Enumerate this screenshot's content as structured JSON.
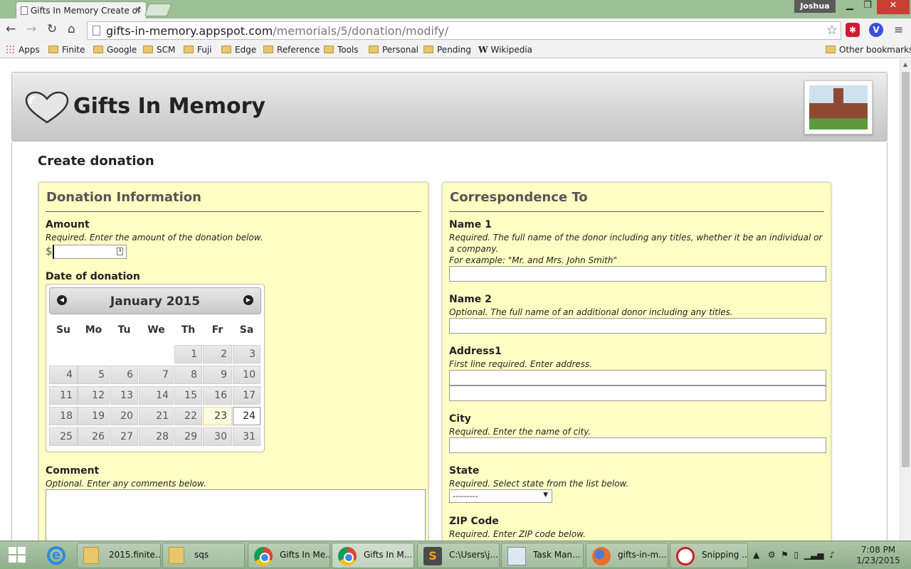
{
  "browser": {
    "tab_title": "Gifts In Memory Create of",
    "user": "Joshua",
    "url_host": "gifts-in-memory.appspot.com",
    "url_path": "/memorials/5/donation/modify/",
    "bookmarks": [
      "Apps",
      "Finite",
      "Google",
      "SCM",
      "Fuji",
      "Edge",
      "Reference",
      "Tools",
      "Personal",
      "Pending",
      "Wikipedia"
    ],
    "other_bookmarks": "Other bookmarks"
  },
  "site": {
    "title": "Gifts In Memory"
  },
  "page": {
    "title": "Create donation"
  },
  "donation": {
    "heading": "Donation Information",
    "amount_label": "Amount",
    "amount_help": "Required. Enter the amount of the donation below.",
    "currency": "$",
    "amount_value": "",
    "date_label": "Date of donation",
    "calendar": {
      "month_year": "January 2015",
      "weekdays": [
        "Su",
        "Mo",
        "Tu",
        "We",
        "Th",
        "Fr",
        "Sa"
      ],
      "first_weekday": 4,
      "days_in_month": 31,
      "today": 23,
      "selected": 24
    },
    "comment_label": "Comment",
    "comment_help": "Optional. Enter any comments below."
  },
  "correspondence": {
    "heading": "Correspondence To",
    "name1_label": "Name 1",
    "name1_help": "Required. The full name of the donor including any titles, whether it be an individual or a company.",
    "name1_example": "For example: \"Mr. and Mrs. John Smith\"",
    "name2_label": "Name 2",
    "name2_help": "Optional. The full name of an additional donor including any titles.",
    "address_label": "Address1",
    "address_help": "First line required. Enter address.",
    "city_label": "City",
    "city_help": "Required. Enter the name of city.",
    "state_label": "State",
    "state_help": "Required. Select state from the list below.",
    "state_selected": "---------",
    "zip_label": "ZIP Code",
    "zip_help": "Required. Enter ZIP code below."
  },
  "taskbar": {
    "buttons": [
      "2015.finite...",
      "sqs",
      "Gifts In Me...",
      "Gifts In M...",
      "C:\\Users\\j...",
      "Task Man...",
      "gifts-in-m...",
      "Snipping ..."
    ],
    "time": "7:08 PM",
    "date": "1/23/2015"
  }
}
